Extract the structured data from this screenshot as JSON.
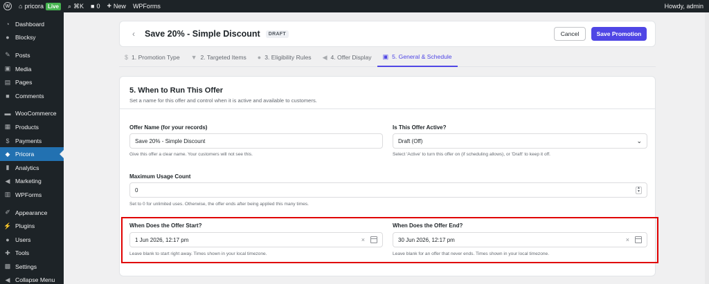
{
  "adminbar": {
    "site_name": "pricora",
    "live_badge": "Live",
    "shortcut": "⌘K",
    "comments_count": "0",
    "new_label": "New",
    "wpforms_label": "WPForms",
    "howdy": "Howdy, admin"
  },
  "sidebar": {
    "items": [
      {
        "label": "Dashboard",
        "icon": "dashboard-icon"
      },
      {
        "label": "Blocksy",
        "icon": "blocksy-icon"
      },
      {
        "label": "Posts",
        "icon": "pin-icon"
      },
      {
        "label": "Media",
        "icon": "media-icon"
      },
      {
        "label": "Pages",
        "icon": "page-icon"
      },
      {
        "label": "Comments",
        "icon": "comment-icon"
      },
      {
        "label": "WooCommerce",
        "icon": "woocommerce-icon"
      },
      {
        "label": "Products",
        "icon": "archive-icon"
      },
      {
        "label": "Payments",
        "icon": "dollar-icon"
      },
      {
        "label": "Pricora",
        "icon": "pricora-icon"
      },
      {
        "label": "Analytics",
        "icon": "bar-chart-icon"
      },
      {
        "label": "Marketing",
        "icon": "megaphone-icon"
      },
      {
        "label": "WPForms",
        "icon": "form-icon"
      },
      {
        "label": "Appearance",
        "icon": "brush-icon"
      },
      {
        "label": "Plugins",
        "icon": "plugin-icon"
      },
      {
        "label": "Users",
        "icon": "user-icon"
      },
      {
        "label": "Tools",
        "icon": "wrench-icon"
      },
      {
        "label": "Settings",
        "icon": "settings-icon"
      },
      {
        "label": "Collapse Menu",
        "icon": "collapse-icon"
      }
    ],
    "active_color": "#2271b1"
  },
  "header": {
    "title": "Save 20% - Simple Discount",
    "status_badge": "DRAFT",
    "cancel_label": "Cancel",
    "save_label": "Save Promotion",
    "accent_color": "#4f46e5"
  },
  "tabs": [
    {
      "label": "1. Promotion Type",
      "icon": "dollar-circle-icon"
    },
    {
      "label": "2. Targeted Items",
      "icon": "filter-icon"
    },
    {
      "label": "3. Eligibility Rules",
      "icon": "person-icon"
    },
    {
      "label": "4. Offer Display",
      "icon": "megaphone-icon"
    },
    {
      "label": "5. General & Schedule",
      "icon": "schedule-icon",
      "active": true
    }
  ],
  "section": {
    "title": "5. When to Run This Offer",
    "description": "Set a name for this offer and control when it is active and available to customers."
  },
  "fields": {
    "offer_name": {
      "label": "Offer Name (for your records)",
      "value": "Save 20% - Simple Discount",
      "help": "Give this offer a clear name. Your customers will not see this."
    },
    "active": {
      "label": "Is This Offer Active?",
      "value": "Draft (Off)",
      "help": "Select 'Active' to turn this offer on (if scheduling allows), or 'Draft' to keep it off."
    },
    "max_usage": {
      "label": "Maximum Usage Count",
      "value": "0",
      "help": "Set to 0 for unlimited uses. Otherwise, the offer ends after being applied this many times."
    },
    "start": {
      "label": "When Does the Offer Start?",
      "value": "1 Jun 2026, 12:17 pm",
      "help": "Leave blank to start right away. Times shown in your local timezone."
    },
    "end": {
      "label": "When Does the Offer End?",
      "value": "30 Jun 2026, 12:17 pm",
      "help": "Leave blank for an offer that never ends. Times shown in your local timezone."
    }
  },
  "highlight_color": "#e00000"
}
